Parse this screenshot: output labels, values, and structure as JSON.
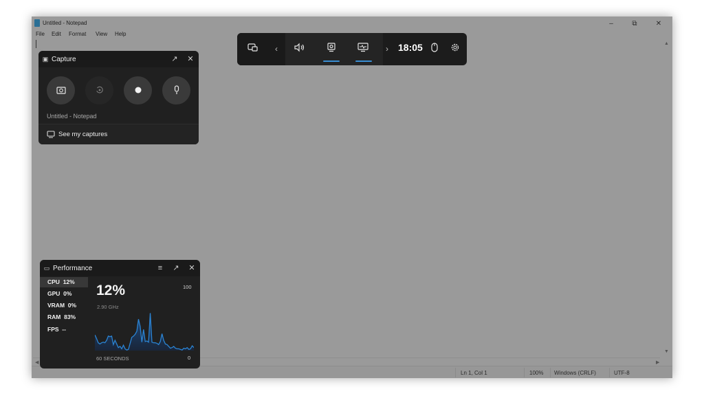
{
  "window": {
    "title": "Untitled - Notepad",
    "controls": {
      "minimize": "–",
      "restore": "⧉",
      "close": "✕"
    }
  },
  "menu": [
    "File",
    "Edit",
    "Format",
    "View",
    "Help"
  ],
  "editor": {
    "content": ""
  },
  "statusbar": {
    "position": "Ln 1, Col 1",
    "zoom": "100%",
    "line_endings": "Windows (CRLF)",
    "encoding": "UTF-8"
  },
  "gamebar": {
    "time": "18:05",
    "icons": [
      "widget-menu-icon",
      "chevron-left-icon",
      "audio-icon",
      "capture-icon",
      "performance-icon",
      "chevron-right-icon",
      "mouse-icon",
      "settings-icon"
    ],
    "active_widgets": [
      "capture",
      "performance"
    ]
  },
  "capture": {
    "title": "Capture",
    "source": "Untitled - Notepad",
    "footer_label": "See my captures",
    "buttons": [
      "screenshot",
      "record-last-30s",
      "start-recording",
      "microphone"
    ]
  },
  "performance": {
    "title": "Performance",
    "metrics": [
      {
        "label": "CPU",
        "value": "12%",
        "selected": true
      },
      {
        "label": "GPU",
        "value": "0%"
      },
      {
        "label": "VRAM",
        "value": "0%"
      },
      {
        "label": "RAM",
        "value": "83%"
      },
      {
        "label": "FPS",
        "value": "--"
      }
    ],
    "big_value": "12%",
    "frequency": "2.90 GHz",
    "axis_max": "100",
    "axis_min": "0",
    "time_label": "60 SECONDS"
  },
  "chart_data": {
    "type": "area",
    "title": "CPU",
    "xlabel": "60 SECONDS",
    "ylabel": "",
    "ylim": [
      0,
      100
    ],
    "color": "#2b84d4",
    "x_count": 60,
    "values": [
      26,
      20,
      13,
      11,
      13,
      14,
      13,
      17,
      24,
      23,
      24,
      10,
      17,
      11,
      5,
      7,
      3,
      9,
      3,
      1,
      2,
      12,
      22,
      24,
      27,
      32,
      52,
      40,
      14,
      35,
      15,
      16,
      14,
      62,
      14,
      13,
      13,
      12,
      10,
      15,
      28,
      17,
      11,
      10,
      7,
      4,
      5,
      7,
      4,
      3,
      3,
      2,
      1,
      4,
      3,
      5,
      2,
      3,
      8,
      5
    ]
  }
}
